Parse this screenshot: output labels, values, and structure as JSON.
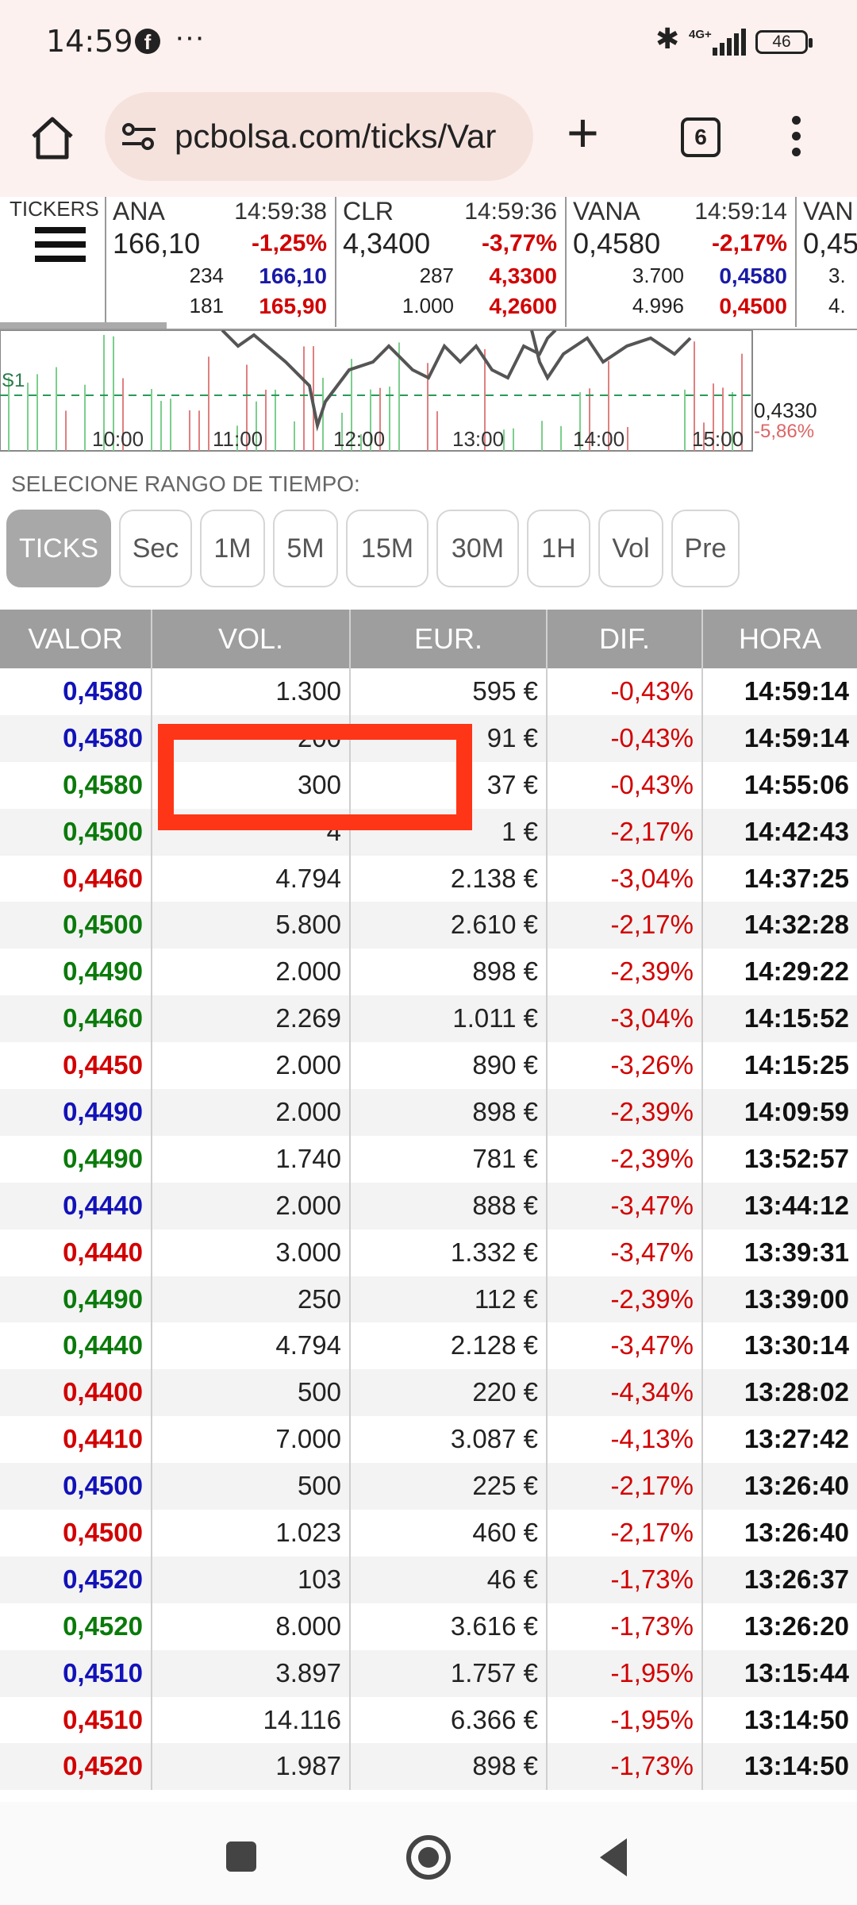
{
  "status_bar": {
    "time": "14:59",
    "battery": "46",
    "network": "4G+"
  },
  "browser": {
    "url": "pcbolsa.com/ticks/Var",
    "tab_count": "6"
  },
  "tickers": {
    "label": "TICKERS",
    "items": [
      {
        "name": "ANA",
        "time": "14:59:38",
        "price": "166,10",
        "change": "-1,25%",
        "bid_vol": "234",
        "bid": "166,10",
        "ask_vol": "181",
        "ask": "165,90"
      },
      {
        "name": "CLR",
        "time": "14:59:36",
        "price": "4,3400",
        "change": "-3,77%",
        "bid_vol": "287",
        "bid": "4,3300",
        "ask_vol": "1.000",
        "ask": "4,2600"
      },
      {
        "name": "VANA",
        "time": "14:59:14",
        "price": "0,4580",
        "change": "-2,17%",
        "bid_vol": "3.700",
        "bid": "0,4580",
        "ask_vol": "4.996",
        "ask": "0,4500"
      },
      {
        "name": "VAN",
        "time": "",
        "price": "0,45",
        "change": "",
        "bid_vol": "3.",
        "bid": "",
        "ask_vol": "4.",
        "ask": ""
      }
    ]
  },
  "chart": {
    "times": [
      "10:00",
      "11:00",
      "12:00",
      "13:00",
      "14:00",
      "15:00"
    ],
    "support_label": "S1",
    "last_price": "0,4330",
    "last_change": "-5,86%"
  },
  "range": {
    "label": "SELECIONE RANGO DE TIEMPO:",
    "buttons": [
      "TICKS",
      "Sec",
      "1M",
      "5M",
      "15M",
      "30M",
      "1H",
      "Vol",
      "Pre"
    ],
    "active": "TICKS"
  },
  "table": {
    "headers": [
      "VALOR",
      "VOL.",
      "EUR.",
      "DIF.",
      "HORA"
    ],
    "colors": {
      "blue": "#1212b8",
      "green": "#0a7a0a",
      "red": "#d20000"
    },
    "rows": [
      {
        "valor": "0,4580",
        "c": "blue",
        "vol": "1.300",
        "eur": "595 €",
        "dif": "-0,43%",
        "hora": "14:59:14"
      },
      {
        "valor": "0,4580",
        "c": "blue",
        "vol": "200",
        "eur": "91 €",
        "dif": "-0,43%",
        "hora": "14:59:14"
      },
      {
        "valor": "0,4580",
        "c": "green",
        "vol": "300",
        "eur": "37 €",
        "dif": "-0,43%",
        "hora": "14:55:06"
      },
      {
        "valor": "0,4500",
        "c": "green",
        "vol": "4",
        "eur": "1 €",
        "dif": "-2,17%",
        "hora": "14:42:43"
      },
      {
        "valor": "0,4460",
        "c": "red",
        "vol": "4.794",
        "eur": "2.138 €",
        "dif": "-3,04%",
        "hora": "14:37:25"
      },
      {
        "valor": "0,4500",
        "c": "green",
        "vol": "5.800",
        "eur": "2.610 €",
        "dif": "-2,17%",
        "hora": "14:32:28"
      },
      {
        "valor": "0,4490",
        "c": "green",
        "vol": "2.000",
        "eur": "898 €",
        "dif": "-2,39%",
        "hora": "14:29:22"
      },
      {
        "valor": "0,4460",
        "c": "green",
        "vol": "2.269",
        "eur": "1.011 €",
        "dif": "-3,04%",
        "hora": "14:15:52"
      },
      {
        "valor": "0,4450",
        "c": "red",
        "vol": "2.000",
        "eur": "890 €",
        "dif": "-3,26%",
        "hora": "14:15:25"
      },
      {
        "valor": "0,4490",
        "c": "blue",
        "vol": "2.000",
        "eur": "898 €",
        "dif": "-2,39%",
        "hora": "14:09:59"
      },
      {
        "valor": "0,4490",
        "c": "green",
        "vol": "1.740",
        "eur": "781 €",
        "dif": "-2,39%",
        "hora": "13:52:57"
      },
      {
        "valor": "0,4440",
        "c": "blue",
        "vol": "2.000",
        "eur": "888 €",
        "dif": "-3,47%",
        "hora": "13:44:12"
      },
      {
        "valor": "0,4440",
        "c": "red",
        "vol": "3.000",
        "eur": "1.332 €",
        "dif": "-3,47%",
        "hora": "13:39:31"
      },
      {
        "valor": "0,4490",
        "c": "green",
        "vol": "250",
        "eur": "112 €",
        "dif": "-2,39%",
        "hora": "13:39:00"
      },
      {
        "valor": "0,4440",
        "c": "green",
        "vol": "4.794",
        "eur": "2.128 €",
        "dif": "-3,47%",
        "hora": "13:30:14"
      },
      {
        "valor": "0,4400",
        "c": "red",
        "vol": "500",
        "eur": "220 €",
        "dif": "-4,34%",
        "hora": "13:28:02"
      },
      {
        "valor": "0,4410",
        "c": "red",
        "vol": "7.000",
        "eur": "3.087 €",
        "dif": "-4,13%",
        "hora": "13:27:42"
      },
      {
        "valor": "0,4500",
        "c": "blue",
        "vol": "500",
        "eur": "225 €",
        "dif": "-2,17%",
        "hora": "13:26:40"
      },
      {
        "valor": "0,4500",
        "c": "red",
        "vol": "1.023",
        "eur": "460 €",
        "dif": "-2,17%",
        "hora": "13:26:40"
      },
      {
        "valor": "0,4520",
        "c": "blue",
        "vol": "103",
        "eur": "46 €",
        "dif": "-1,73%",
        "hora": "13:26:37"
      },
      {
        "valor": "0,4520",
        "c": "green",
        "vol": "8.000",
        "eur": "3.616 €",
        "dif": "-1,73%",
        "hora": "13:26:20"
      },
      {
        "valor": "0,4510",
        "c": "blue",
        "vol": "3.897",
        "eur": "1.757 €",
        "dif": "-1,95%",
        "hora": "13:15:44"
      },
      {
        "valor": "0,4510",
        "c": "red",
        "vol": "14.116",
        "eur": "6.366 €",
        "dif": "-1,95%",
        "hora": "13:14:50"
      },
      {
        "valor": "0,4520",
        "c": "red",
        "vol": "1.987",
        "eur": "898 €",
        "dif": "-1,73%",
        "hora": "13:14:50"
      }
    ]
  }
}
